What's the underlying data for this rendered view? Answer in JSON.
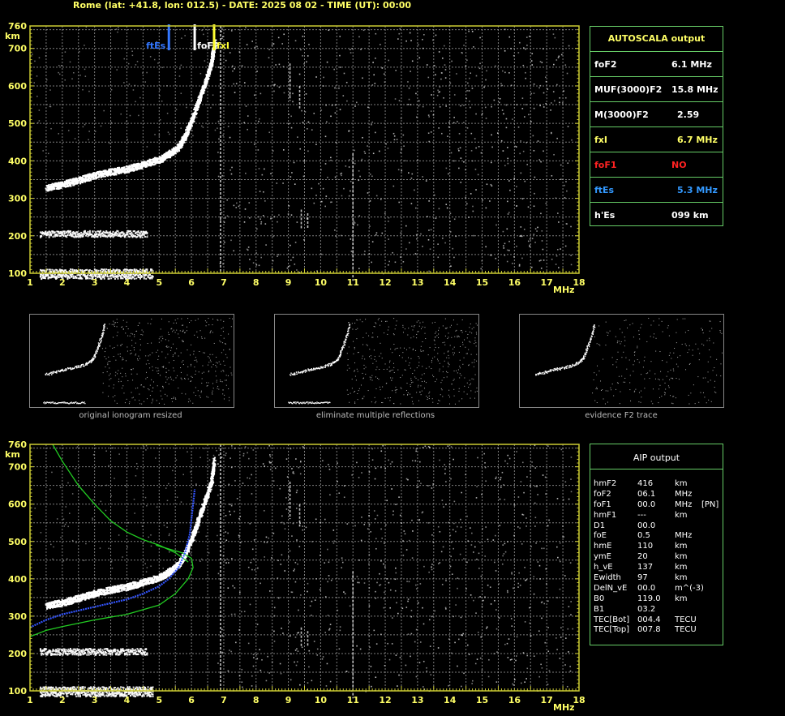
{
  "header": {
    "text": "Rome (lat: +41.8, lon: 012.5) - DATE: 2025 08 02 - TIME (UT): 00:00"
  },
  "colors": {
    "grid": "#b3b3b3",
    "frame": "#cccc33",
    "label": "#ffff66",
    "panel_border": "#66cc66",
    "ftEs": "#3377ff",
    "fxI": "#ffff33",
    "foF1": "#ff2222",
    "model_curve": "#22cc22",
    "fit_curve": "#3355ff"
  },
  "chart_data": [
    {
      "type": "scatter",
      "name": "top-ionogram",
      "ylabel": "km",
      "xlabel": "MHz",
      "xlim": [
        1,
        18
      ],
      "ylim": [
        100,
        760
      ],
      "x_ticks": [
        "1",
        "2",
        "3",
        "4",
        "5",
        "6",
        "7",
        "8",
        "9",
        "10",
        "11",
        "12",
        "13",
        "14",
        "15",
        "16",
        "17",
        "18"
      ],
      "y_ticks": [
        "100",
        "200",
        "300",
        "400",
        "500",
        "600",
        "700",
        "760"
      ],
      "markers": [
        {
          "label": "ftEs",
          "x": 5.3,
          "color": "#3377ff"
        },
        {
          "label": "foF2",
          "x": 6.1,
          "color": "#ffffff"
        },
        {
          "label": "fxI",
          "x": 6.7,
          "color": "#ffff33"
        }
      ],
      "traces": {
        "f2_trace": [
          [
            1.5,
            330
          ],
          [
            2,
            338
          ],
          [
            2.5,
            350
          ],
          [
            3,
            363
          ],
          [
            3.5,
            372
          ],
          [
            4,
            380
          ],
          [
            4.5,
            392
          ],
          [
            5,
            405
          ],
          [
            5.3,
            420
          ],
          [
            5.6,
            440
          ],
          [
            5.8,
            470
          ],
          [
            6.0,
            510
          ],
          [
            6.2,
            560
          ],
          [
            6.4,
            610
          ],
          [
            6.6,
            660
          ],
          [
            6.7,
            720
          ]
        ],
        "e_layer": [
          [
            1.3,
            105
          ],
          [
            4.8,
            105
          ]
        ],
        "es_layer": [
          [
            1.3,
            210
          ],
          [
            4.6,
            210
          ]
        ]
      }
    },
    {
      "type": "scatter",
      "name": "bottom-ionogram",
      "ylabel": "km",
      "xlabel": "MHz",
      "xlim": [
        1,
        18
      ],
      "ylim": [
        100,
        760
      ],
      "x_ticks": [
        "1",
        "2",
        "3",
        "4",
        "5",
        "6",
        "7",
        "8",
        "9",
        "10",
        "11",
        "12",
        "13",
        "14",
        "15",
        "16",
        "17",
        "18"
      ],
      "y_ticks": [
        "100",
        "200",
        "300",
        "400",
        "500",
        "600",
        "700",
        "760"
      ],
      "curves": {
        "blue_fit": [
          [
            1,
            270
          ],
          [
            1.5,
            290
          ],
          [
            2,
            305
          ],
          [
            3,
            325
          ],
          [
            4,
            345
          ],
          [
            4.5,
            360
          ],
          [
            5,
            380
          ],
          [
            5.3,
            400
          ],
          [
            5.6,
            430
          ],
          [
            5.8,
            470
          ],
          [
            5.95,
            520
          ],
          [
            6.0,
            560
          ],
          [
            6.05,
            600
          ],
          [
            6.1,
            640
          ]
        ],
        "green_lower": [
          [
            1,
            245
          ],
          [
            1.5,
            262
          ],
          [
            2,
            272
          ],
          [
            3,
            290
          ],
          [
            4,
            305
          ],
          [
            5,
            330
          ],
          [
            5.5,
            360
          ],
          [
            5.9,
            400
          ],
          [
            6.05,
            430
          ],
          [
            6.0,
            455
          ],
          [
            5.7,
            470
          ],
          [
            5.3,
            480
          ],
          [
            4.9,
            490
          ]
        ],
        "green_upper": [
          [
            1.7,
            760
          ],
          [
            2,
            715
          ],
          [
            2.5,
            650
          ],
          [
            3,
            600
          ],
          [
            3.5,
            555
          ],
          [
            4,
            525
          ],
          [
            4.5,
            505
          ],
          [
            5,
            490
          ],
          [
            5.5,
            470
          ],
          [
            5.9,
            445
          ]
        ]
      }
    }
  ],
  "autoscala": {
    "title": "AUTOSCALA output",
    "rows": [
      {
        "label": "foF2",
        "value": "6.1  MHz",
        "color": "#ffffff"
      },
      {
        "label": "MUF(3000)F2",
        "value": "15.8 MHz",
        "color": "#ffffff"
      },
      {
        "label": "M(3000)F2",
        "value": "2.59",
        "color": "#ffffff"
      },
      {
        "label": "fxI",
        "value": "6.7  MHz",
        "color": "#ffff66"
      },
      {
        "label": "foF1",
        "value": "NO",
        "color": "#ff2222"
      },
      {
        "label": "ftEs",
        "value": "5.3  MHz",
        "color": "#3399ff"
      },
      {
        "label": "h'Es",
        "value": "099     km",
        "color": "#ffffff"
      }
    ]
  },
  "thumbnails": [
    {
      "caption": "original ionogram resized"
    },
    {
      "caption": "eliminate multiple reflections"
    },
    {
      "caption": "evidence F2 trace"
    }
  ],
  "aip": {
    "title": "AIP output",
    "rows": [
      {
        "name": "hmF2",
        "value": "416",
        "unit": "km",
        "extra": ""
      },
      {
        "name": "foF2",
        "value": "06.1",
        "unit": "MHz",
        "extra": ""
      },
      {
        "name": "foF1",
        "value": "00.0",
        "unit": "MHz",
        "extra": "[PN]"
      },
      {
        "name": "hmF1",
        "value": "---",
        "unit": "km",
        "extra": ""
      },
      {
        "name": "D1",
        "value": "00.0",
        "unit": "",
        "extra": ""
      },
      {
        "name": "foE",
        "value": "0.5",
        "unit": "MHz",
        "extra": ""
      },
      {
        "name": "hmE",
        "value": "110",
        "unit": "km",
        "extra": ""
      },
      {
        "name": "ymE",
        "value": "20",
        "unit": "km",
        "extra": ""
      },
      {
        "name": "h_vE",
        "value": "137",
        "unit": "km",
        "extra": ""
      },
      {
        "name": "Ewidth",
        "value": "97",
        "unit": "km",
        "extra": ""
      },
      {
        "name": "DelN_vE",
        "value": "00.0",
        "unit": "m^(-3)",
        "extra": ""
      },
      {
        "name": "B0",
        "value": "119.0",
        "unit": "km",
        "extra": ""
      },
      {
        "name": "B1",
        "value": "03.2",
        "unit": "",
        "extra": ""
      },
      {
        "name": "TEC[Bot]",
        "value": "004.4",
        "unit": "TECU",
        "extra": ""
      },
      {
        "name": "TEC[Top]",
        "value": "007.8",
        "unit": "TECU",
        "extra": ""
      }
    ]
  }
}
